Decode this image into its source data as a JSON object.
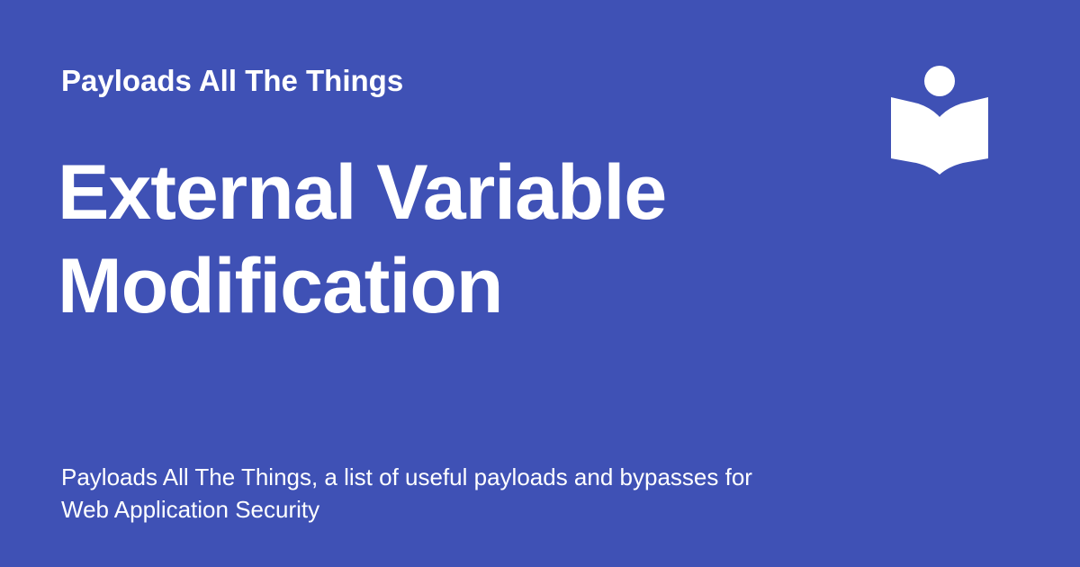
{
  "site": {
    "name": "Payloads All The Things"
  },
  "page": {
    "title_line_1": "External Variable",
    "title_line_2": "Modification"
  },
  "description": {
    "line_1": "Payloads All The Things, a list of useful payloads and bypasses for",
    "line_2": "Web Application Security"
  },
  "logo": {
    "icon": "reading-person-icon"
  },
  "colors": {
    "background": "#3f51b5",
    "text": "#ffffff"
  }
}
